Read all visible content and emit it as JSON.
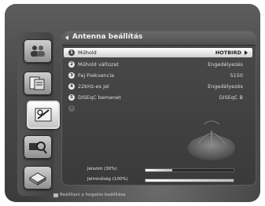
{
  "menu": {
    "title": "Antenna beállítás",
    "items": [
      {
        "num": "1",
        "label": "Műhold",
        "value": "HOTBIRD",
        "selected": true
      },
      {
        "num": "2",
        "label": "Műhold változat",
        "value": "Engedélyezés"
      },
      {
        "num": "3",
        "label": "Fej Frekvencia",
        "value": "5150"
      },
      {
        "num": "4",
        "label": "22kHz-es jel",
        "value": "Engedélyezés"
      },
      {
        "num": "5",
        "label": "DiSEqC bemenet",
        "value": "DiSEqC B"
      },
      {
        "num": "6",
        "label": "",
        "value": "",
        "disabled": true
      }
    ]
  },
  "signal": {
    "strength_label": "Jelszint (30%)",
    "strength_value": 30,
    "quality_label": "Jelminőség (100%)",
    "quality_value": 100
  },
  "footer": {
    "hint": "Beállítani a forgatós beállítása"
  },
  "sidebar": {
    "icons": [
      "users-icon",
      "file-tree-icon",
      "satellite-icon",
      "search-icon",
      "disk-icon"
    ],
    "selected": "satellite-icon"
  }
}
